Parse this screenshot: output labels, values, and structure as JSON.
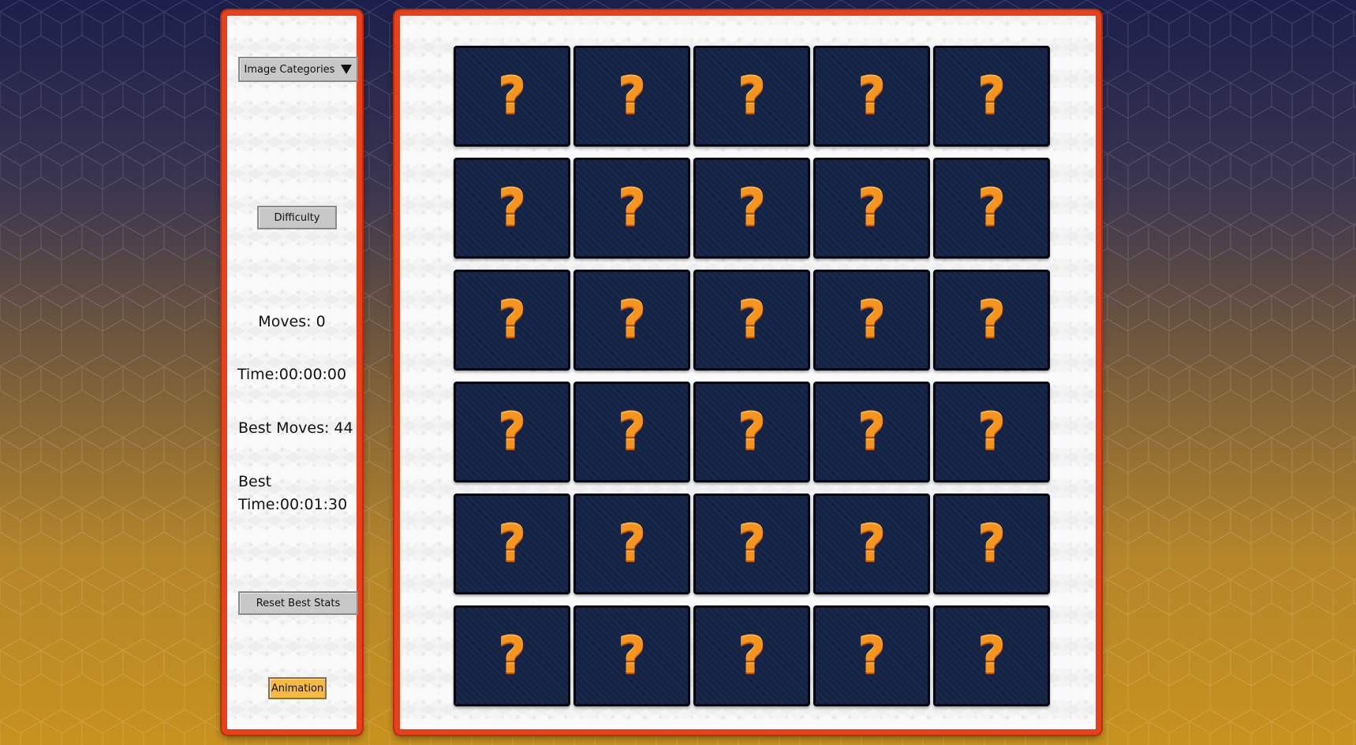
{
  "colors": {
    "panel_border": "#e8401a",
    "card_back": "#142244",
    "question_mark": "#f7941d",
    "button": "#c8c8c8",
    "animation_button": "#f6b944"
  },
  "sidebar": {
    "categories_label": "Image Categories",
    "categories_icon": "caret-down-icon",
    "difficulty_label": "Difficulty",
    "moves": "Moves: 0",
    "time": "Time:00:00:00",
    "best_moves": "Best Moves: 44",
    "best_time": "Best Time:00:01:30",
    "reset_label": "Reset Best Stats",
    "animation_label": "Animation"
  },
  "board": {
    "rows": 6,
    "columns": 5,
    "cards": [
      {
        "face": "?",
        "icon": "question-mark-icon",
        "flipped": false
      },
      {
        "face": "?",
        "icon": "question-mark-icon",
        "flipped": false
      },
      {
        "face": "?",
        "icon": "question-mark-icon",
        "flipped": false
      },
      {
        "face": "?",
        "icon": "question-mark-icon",
        "flipped": false
      },
      {
        "face": "?",
        "icon": "question-mark-icon",
        "flipped": false
      },
      {
        "face": "?",
        "icon": "question-mark-icon",
        "flipped": false
      },
      {
        "face": "?",
        "icon": "question-mark-icon",
        "flipped": false
      },
      {
        "face": "?",
        "icon": "question-mark-icon",
        "flipped": false
      },
      {
        "face": "?",
        "icon": "question-mark-icon",
        "flipped": false
      },
      {
        "face": "?",
        "icon": "question-mark-icon",
        "flipped": false
      },
      {
        "face": "?",
        "icon": "question-mark-icon",
        "flipped": false
      },
      {
        "face": "?",
        "icon": "question-mark-icon",
        "flipped": false
      },
      {
        "face": "?",
        "icon": "question-mark-icon",
        "flipped": false
      },
      {
        "face": "?",
        "icon": "question-mark-icon",
        "flipped": false
      },
      {
        "face": "?",
        "icon": "question-mark-icon",
        "flipped": false
      },
      {
        "face": "?",
        "icon": "question-mark-icon",
        "flipped": false
      },
      {
        "face": "?",
        "icon": "question-mark-icon",
        "flipped": false
      },
      {
        "face": "?",
        "icon": "question-mark-icon",
        "flipped": false
      },
      {
        "face": "?",
        "icon": "question-mark-icon",
        "flipped": false
      },
      {
        "face": "?",
        "icon": "question-mark-icon",
        "flipped": false
      },
      {
        "face": "?",
        "icon": "question-mark-icon",
        "flipped": false
      },
      {
        "face": "?",
        "icon": "question-mark-icon",
        "flipped": false
      },
      {
        "face": "?",
        "icon": "question-mark-icon",
        "flipped": false
      },
      {
        "face": "?",
        "icon": "question-mark-icon",
        "flipped": false
      },
      {
        "face": "?",
        "icon": "question-mark-icon",
        "flipped": false
      },
      {
        "face": "?",
        "icon": "question-mark-icon",
        "flipped": false
      },
      {
        "face": "?",
        "icon": "question-mark-icon",
        "flipped": false
      },
      {
        "face": "?",
        "icon": "question-mark-icon",
        "flipped": false
      },
      {
        "face": "?",
        "icon": "question-mark-icon",
        "flipped": false
      },
      {
        "face": "?",
        "icon": "question-mark-icon",
        "flipped": false
      }
    ]
  }
}
